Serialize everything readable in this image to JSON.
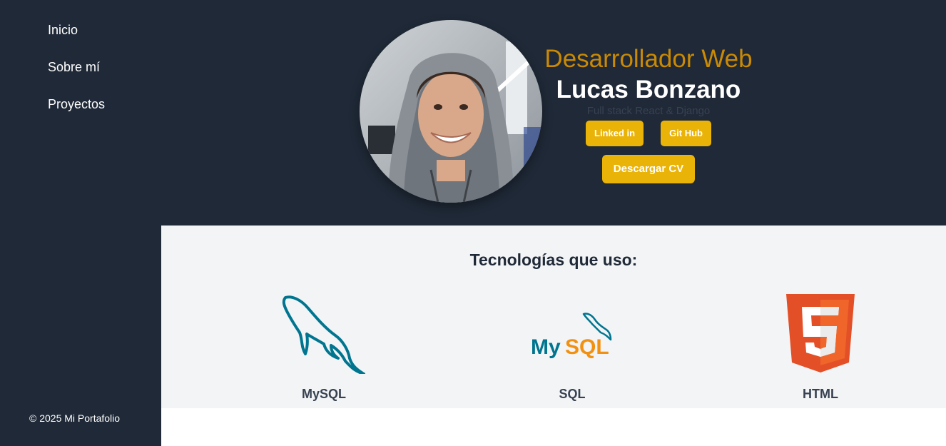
{
  "nav": {
    "items": [
      {
        "label": "Inicio"
      },
      {
        "label": "Sobre mí"
      },
      {
        "label": "Proyectos"
      }
    ],
    "footer": "© 2025 Mi Portafolio"
  },
  "hero": {
    "role": "Desarrollador Web",
    "name": "Lucas Bonzano",
    "stack": "Full stack React & Django",
    "buttons": {
      "linkedin": "Linked in",
      "github": "Git Hub",
      "cv": "Descargar CV"
    }
  },
  "tech": {
    "title": "Tecnologías que uso:",
    "items": [
      {
        "label": "MySQL",
        "icon": "dolphin-icon"
      },
      {
        "label": "SQL",
        "icon": "mysql-logo-icon"
      },
      {
        "label": "HTML",
        "icon": "html5-shield-icon"
      }
    ]
  },
  "colors": {
    "sidebar": "#1f2937",
    "accent": "#eab308",
    "role": "#ca8a04",
    "tech_bg": "#f3f4f6"
  }
}
